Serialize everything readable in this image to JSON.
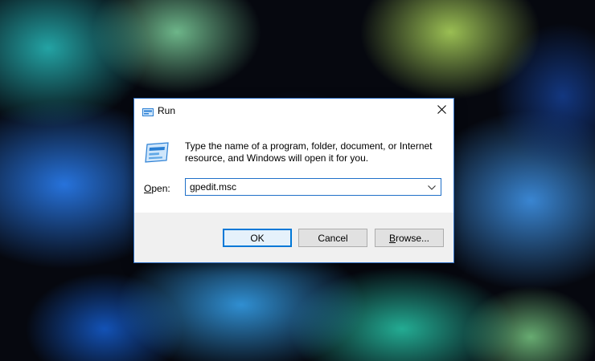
{
  "dialog": {
    "title": "Run",
    "description": "Type the name of a program, folder, document, or Internet resource, and Windows will open it for you.",
    "open_label_mnemonic": "O",
    "open_label_rest": "pen:",
    "open_value": "gpedit.msc",
    "buttons": {
      "ok": "OK",
      "cancel": "Cancel",
      "browse_mnemonic": "B",
      "browse_rest": "rowse..."
    },
    "icons": {
      "title": "run-icon",
      "big": "run-icon",
      "close": "close-icon",
      "dropdown": "chevron-down-icon"
    },
    "colors": {
      "accent": "#0078d7",
      "button_bar": "#f0f0f0"
    }
  }
}
